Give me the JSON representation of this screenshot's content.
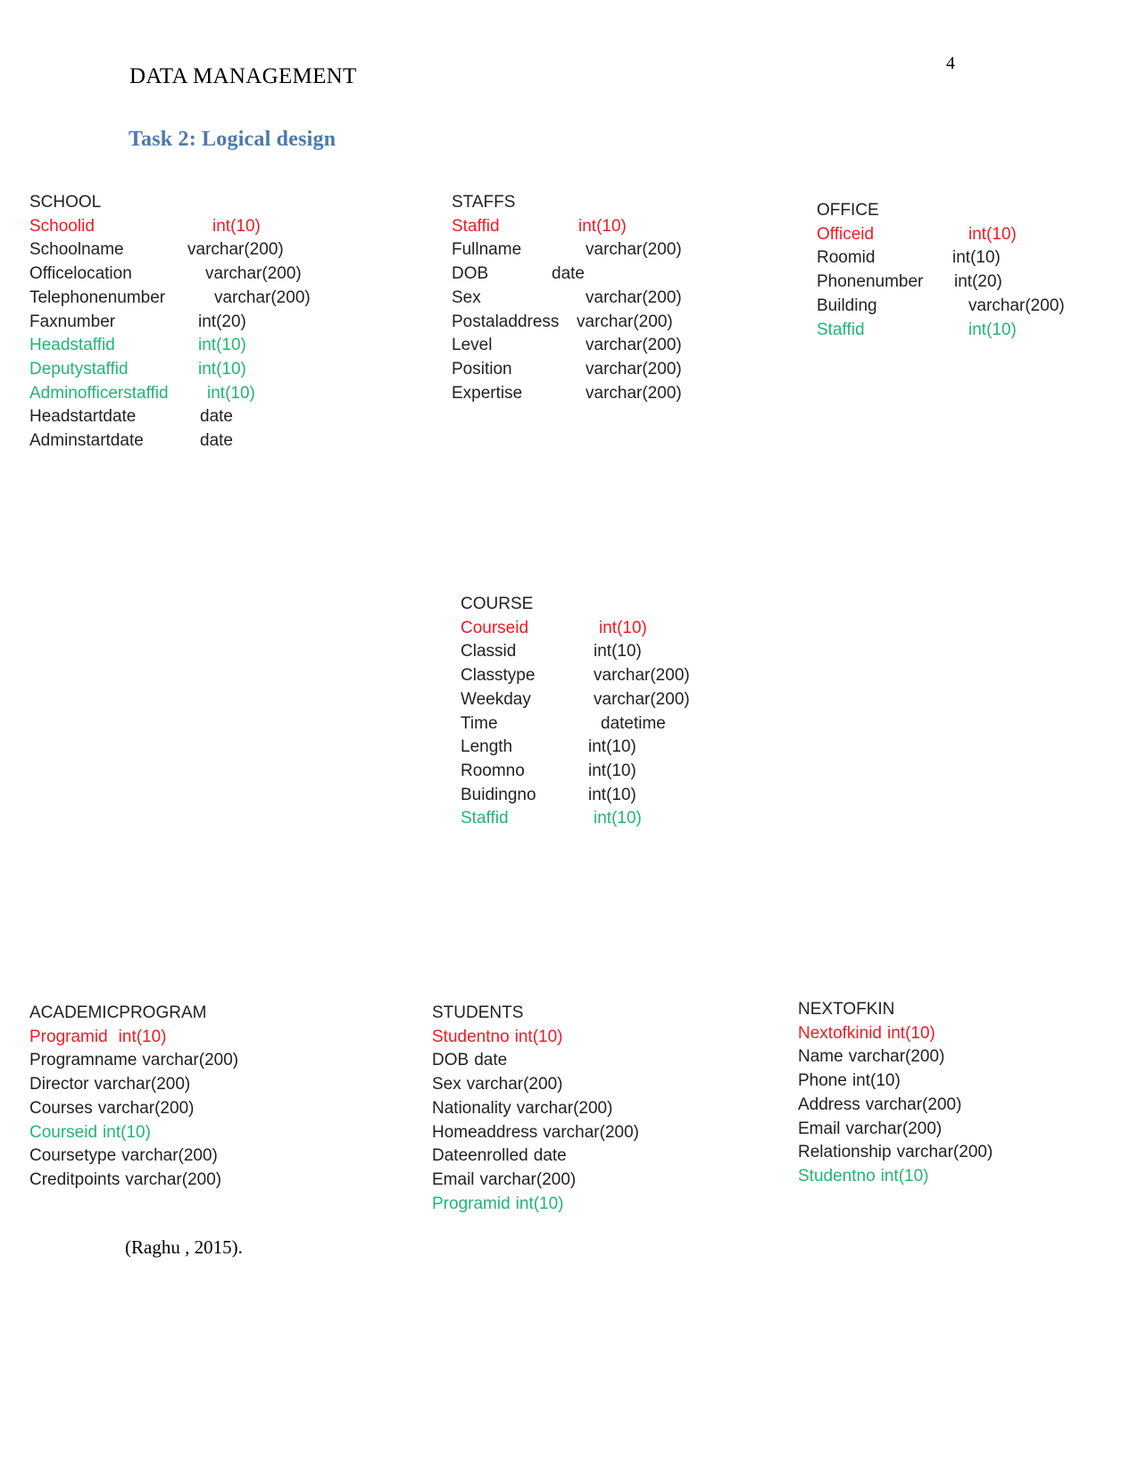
{
  "page": {
    "number": "4",
    "header_title": "DATA MANAGEMENT",
    "task_heading": "Task 2: Logical design",
    "citation": "(Raghu , 2015)."
  },
  "colors": {
    "primary_key": "#ed1c24",
    "foreign_key": "#22b573",
    "normal": "#231f20",
    "heading_blue": "#4a7aac"
  },
  "entities": {
    "school": {
      "name": "SCHOOL",
      "fields": [
        {
          "name": "Schoolid",
          "type": "int(10)",
          "key": "pk"
        },
        {
          "name": "Schoolname",
          "type": "varchar(200)",
          "key": "nk"
        },
        {
          "name": "Officelocation",
          "type": "varchar(200)",
          "key": "nk"
        },
        {
          "name": "Telephonenumber",
          "type": "varchar(200)",
          "key": "nk"
        },
        {
          "name": "Faxnumber",
          "type": "int(20)",
          "key": "nk"
        },
        {
          "name": "Headstaffid",
          "type": "int(10)",
          "key": "fk"
        },
        {
          "name": "Deputystaffid",
          "type": "int(10)",
          "key": "fk"
        },
        {
          "name": "Adminofficerstaffid",
          "type": "int(10)",
          "key": "fk"
        },
        {
          "name": "Headstartdate",
          "type": "date",
          "key": "nk"
        },
        {
          "name": "Adminstartdate",
          "type": "date",
          "key": "nk"
        }
      ]
    },
    "staffs": {
      "name": "STAFFS",
      "fields": [
        {
          "name": "Staffid",
          "type": "int(10)",
          "key": "pk"
        },
        {
          "name": "Fullname",
          "type": "varchar(200)",
          "key": "nk"
        },
        {
          "name": "DOB",
          "type": "date",
          "key": "nk"
        },
        {
          "name": "Sex",
          "type": "varchar(200)",
          "key": "nk"
        },
        {
          "name": "Postaladdress",
          "type": "varchar(200)",
          "key": "nk"
        },
        {
          "name": "Level",
          "type": "varchar(200)",
          "key": "nk"
        },
        {
          "name": "Position",
          "type": "varchar(200)",
          "key": "nk"
        },
        {
          "name": "Expertise",
          "type": "varchar(200)",
          "key": "nk"
        }
      ]
    },
    "office": {
      "name": "OFFICE",
      "fields": [
        {
          "name": "Officeid",
          "type": "int(10)",
          "key": "pk"
        },
        {
          "name": "Roomid",
          "type": "int(10)",
          "key": "nk"
        },
        {
          "name": "Phonenumber",
          "type": "int(20)",
          "key": "nk"
        },
        {
          "name": "Building",
          "type": "varchar(200)",
          "key": "nk"
        },
        {
          "name": "Staffid",
          "type": "int(10)",
          "key": "fk"
        }
      ]
    },
    "course": {
      "name": "COURSE",
      "fields": [
        {
          "name": "Courseid",
          "type": "int(10)",
          "key": "pk"
        },
        {
          "name": "Classid",
          "type": "int(10)",
          "key": "nk"
        },
        {
          "name": "Classtype",
          "type": "varchar(200)",
          "key": "nk"
        },
        {
          "name": "Weekday",
          "type": "varchar(200)",
          "key": "nk"
        },
        {
          "name": "Time",
          "type": "datetime",
          "key": "nk"
        },
        {
          "name": "Length",
          "type": "int(10)",
          "key": "nk"
        },
        {
          "name": "Roomno",
          "type": "int(10)",
          "key": "nk"
        },
        {
          "name": "Buidingno",
          "type": "int(10)",
          "key": "nk"
        },
        {
          "name": "Staffid",
          "type": "int(10)",
          "key": "fk"
        }
      ]
    },
    "academicprogram": {
      "name": "ACADEMICPROGRAM",
      "fields": [
        {
          "name": "Programid",
          "type": "int(10)",
          "key": "pk"
        },
        {
          "name": "Programname",
          "type": "varchar(200)",
          "key": "nk"
        },
        {
          "name": "Director",
          "type": "varchar(200)",
          "key": "nk"
        },
        {
          "name": "Courses",
          "type": "varchar(200)",
          "key": "nk"
        },
        {
          "name": "Courseid",
          "type": "int(10)",
          "key": "fk"
        },
        {
          "name": "Coursetype",
          "type": "varchar(200)",
          "key": "nk"
        },
        {
          "name": "Creditpoints",
          "type": "varchar(200)",
          "key": "nk"
        }
      ]
    },
    "students": {
      "name": "STUDENTS",
      "fields": [
        {
          "name": "Studentno",
          "type": "int(10)",
          "key": "pk"
        },
        {
          "name": "DOB",
          "type": "date",
          "key": "nk"
        },
        {
          "name": "Sex",
          "type": "varchar(200)",
          "key": "nk"
        },
        {
          "name": "Nationality",
          "type": "varchar(200)",
          "key": "nk"
        },
        {
          "name": "Homeaddress",
          "type": "varchar(200)",
          "key": "nk"
        },
        {
          "name": "Dateenrolled",
          "type": "date",
          "key": "nk"
        },
        {
          "name": "Email",
          "type": "varchar(200)",
          "key": "nk"
        },
        {
          "name": "Programid",
          "type": "int(10)",
          "key": "fk"
        }
      ]
    },
    "nextofkin": {
      "name": "NEXTOFKIN",
      "fields": [
        {
          "name": "Nextofkinid",
          "type": "int(10)",
          "key": "pk"
        },
        {
          "name": "Name",
          "type": "varchar(200)",
          "key": "nk"
        },
        {
          "name": "Phone",
          "type": "int(10)",
          "key": "nk"
        },
        {
          "name": "Address",
          "type": "varchar(200)",
          "key": "nk"
        },
        {
          "name": "Email",
          "type": "varchar(200)",
          "key": "nk"
        },
        {
          "name": "Relationship",
          "type": "varchar(200)",
          "key": "nk"
        },
        {
          "name": "Studentno",
          "type": "int(10)",
          "key": "fk"
        }
      ]
    }
  }
}
